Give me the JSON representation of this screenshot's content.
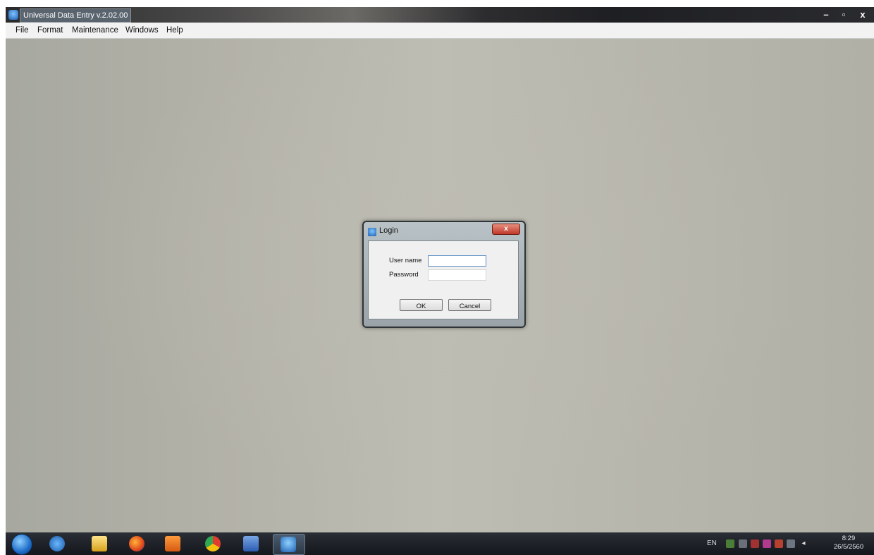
{
  "window": {
    "title": "Universal Data Entry v.2.02.00",
    "minimize_label": "–",
    "maximize_label": "▫",
    "close_label": "x"
  },
  "menu": {
    "items": [
      {
        "label": "File"
      },
      {
        "label": "Format"
      },
      {
        "label": "Maintenance"
      },
      {
        "label": "Windows"
      },
      {
        "label": "Help"
      }
    ]
  },
  "login_dialog": {
    "title": "Login",
    "close_label": "x",
    "username_label": "User name",
    "password_label": "Password",
    "username_value": "",
    "password_value": "",
    "ok_label": "OK",
    "cancel_label": "Cancel"
  },
  "taskbar": {
    "apps": [
      {
        "icon": "internet-explorer-icon"
      },
      {
        "icon": "file-explorer-icon"
      },
      {
        "icon": "firefox-icon"
      },
      {
        "icon": "media-player-icon"
      },
      {
        "icon": "chrome-icon"
      },
      {
        "icon": "word-icon"
      },
      {
        "icon": "universal-data-entry-icon"
      }
    ],
    "language": "EN",
    "volume_glyph": "◂",
    "time": "8:29",
    "date": "26/5/2560"
  }
}
